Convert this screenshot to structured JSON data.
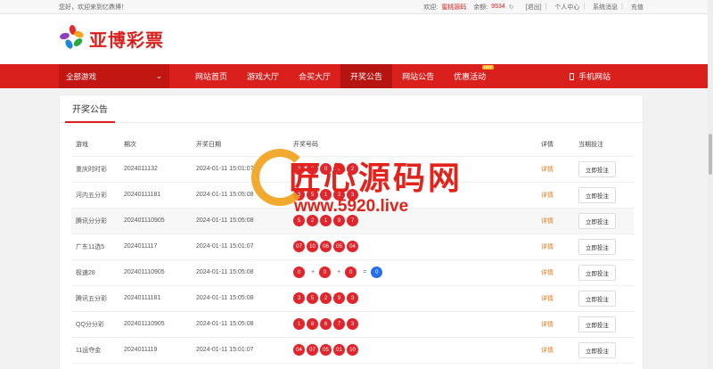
{
  "topbar": {
    "welcome": "您好，欢迎来到亿鼎博！",
    "login_label": "欢迎:",
    "username": "蜜桃源码",
    "balance_label": "余额:",
    "balance": "9534",
    "refresh_icon": "refresh-icon",
    "logout": "[退出]",
    "user_center": "个人中心",
    "messages": "系统消息",
    "recharge": "充值"
  },
  "logo": {
    "text": "亚博彩票",
    "icon": "flower-logo-icon"
  },
  "nav": {
    "all_games": "全部游戏",
    "items": [
      "网站首页",
      "游戏大厅",
      "合买大厅",
      "开奖公告",
      "网站公告",
      "优惠活动"
    ],
    "hot_badge": "HOT",
    "mobile": "手机网站"
  },
  "panel": {
    "tab": "开奖公告",
    "headers": [
      "游戏",
      "期次",
      "开奖日期",
      "开奖号码",
      "详情",
      "当期投注"
    ],
    "detail_label": "详情",
    "bet_label": "立即投注",
    "rows": [
      {
        "game": "重庆时时彩",
        "issue": "2024011132",
        "date": "2024-01-11 15:01:07",
        "balls": [
          "3",
          "8",
          "0",
          "9",
          "2"
        ]
      },
      {
        "game": "河内五分彩",
        "issue": "20240111181",
        "date": "2024-01-11 15:05:08",
        "balls": [
          "3",
          "5",
          "1",
          "2",
          "3"
        ]
      },
      {
        "game": "腾讯分分彩",
        "issue": "202401110905",
        "date": "2024-01-11 15:05:08",
        "balls": [
          "5",
          "2",
          "1",
          "9",
          "7"
        ]
      },
      {
        "game": "广东11选5",
        "issue": "2024011117",
        "date": "2024-01-11 15:01:07",
        "balls": [
          "07",
          "10",
          "06",
          "05",
          "04"
        ]
      },
      {
        "game": "极速28",
        "issue": "202401110905",
        "date": "2024-01-11 15:05:08",
        "pk": [
          "0",
          "0",
          "0"
        ],
        "sum": "0"
      },
      {
        "game": "腾讯五分彩",
        "issue": "20240111181",
        "date": "2024-01-11 15:05:08",
        "balls": [
          "3",
          "5",
          "2",
          "9",
          "3"
        ]
      },
      {
        "game": "QQ分分彩",
        "issue": "202401110905",
        "date": "2024-01-11 15:05:08",
        "balls": [
          "1",
          "8",
          "6",
          "7",
          "3"
        ]
      },
      {
        "game": "11运夺金",
        "issue": "2024011119",
        "date": "2024-01-11 15:01:07",
        "balls": [
          "04",
          "07",
          "05",
          "01",
          "10"
        ]
      }
    ]
  },
  "watermark": {
    "title": "匠心源码网",
    "url": "www.5920.live"
  },
  "colors": {
    "brand_red": "#d9201d",
    "ball_red": "#e0262c",
    "ball_blue": "#2470e8",
    "detail_orange": "#e57a1b"
  }
}
